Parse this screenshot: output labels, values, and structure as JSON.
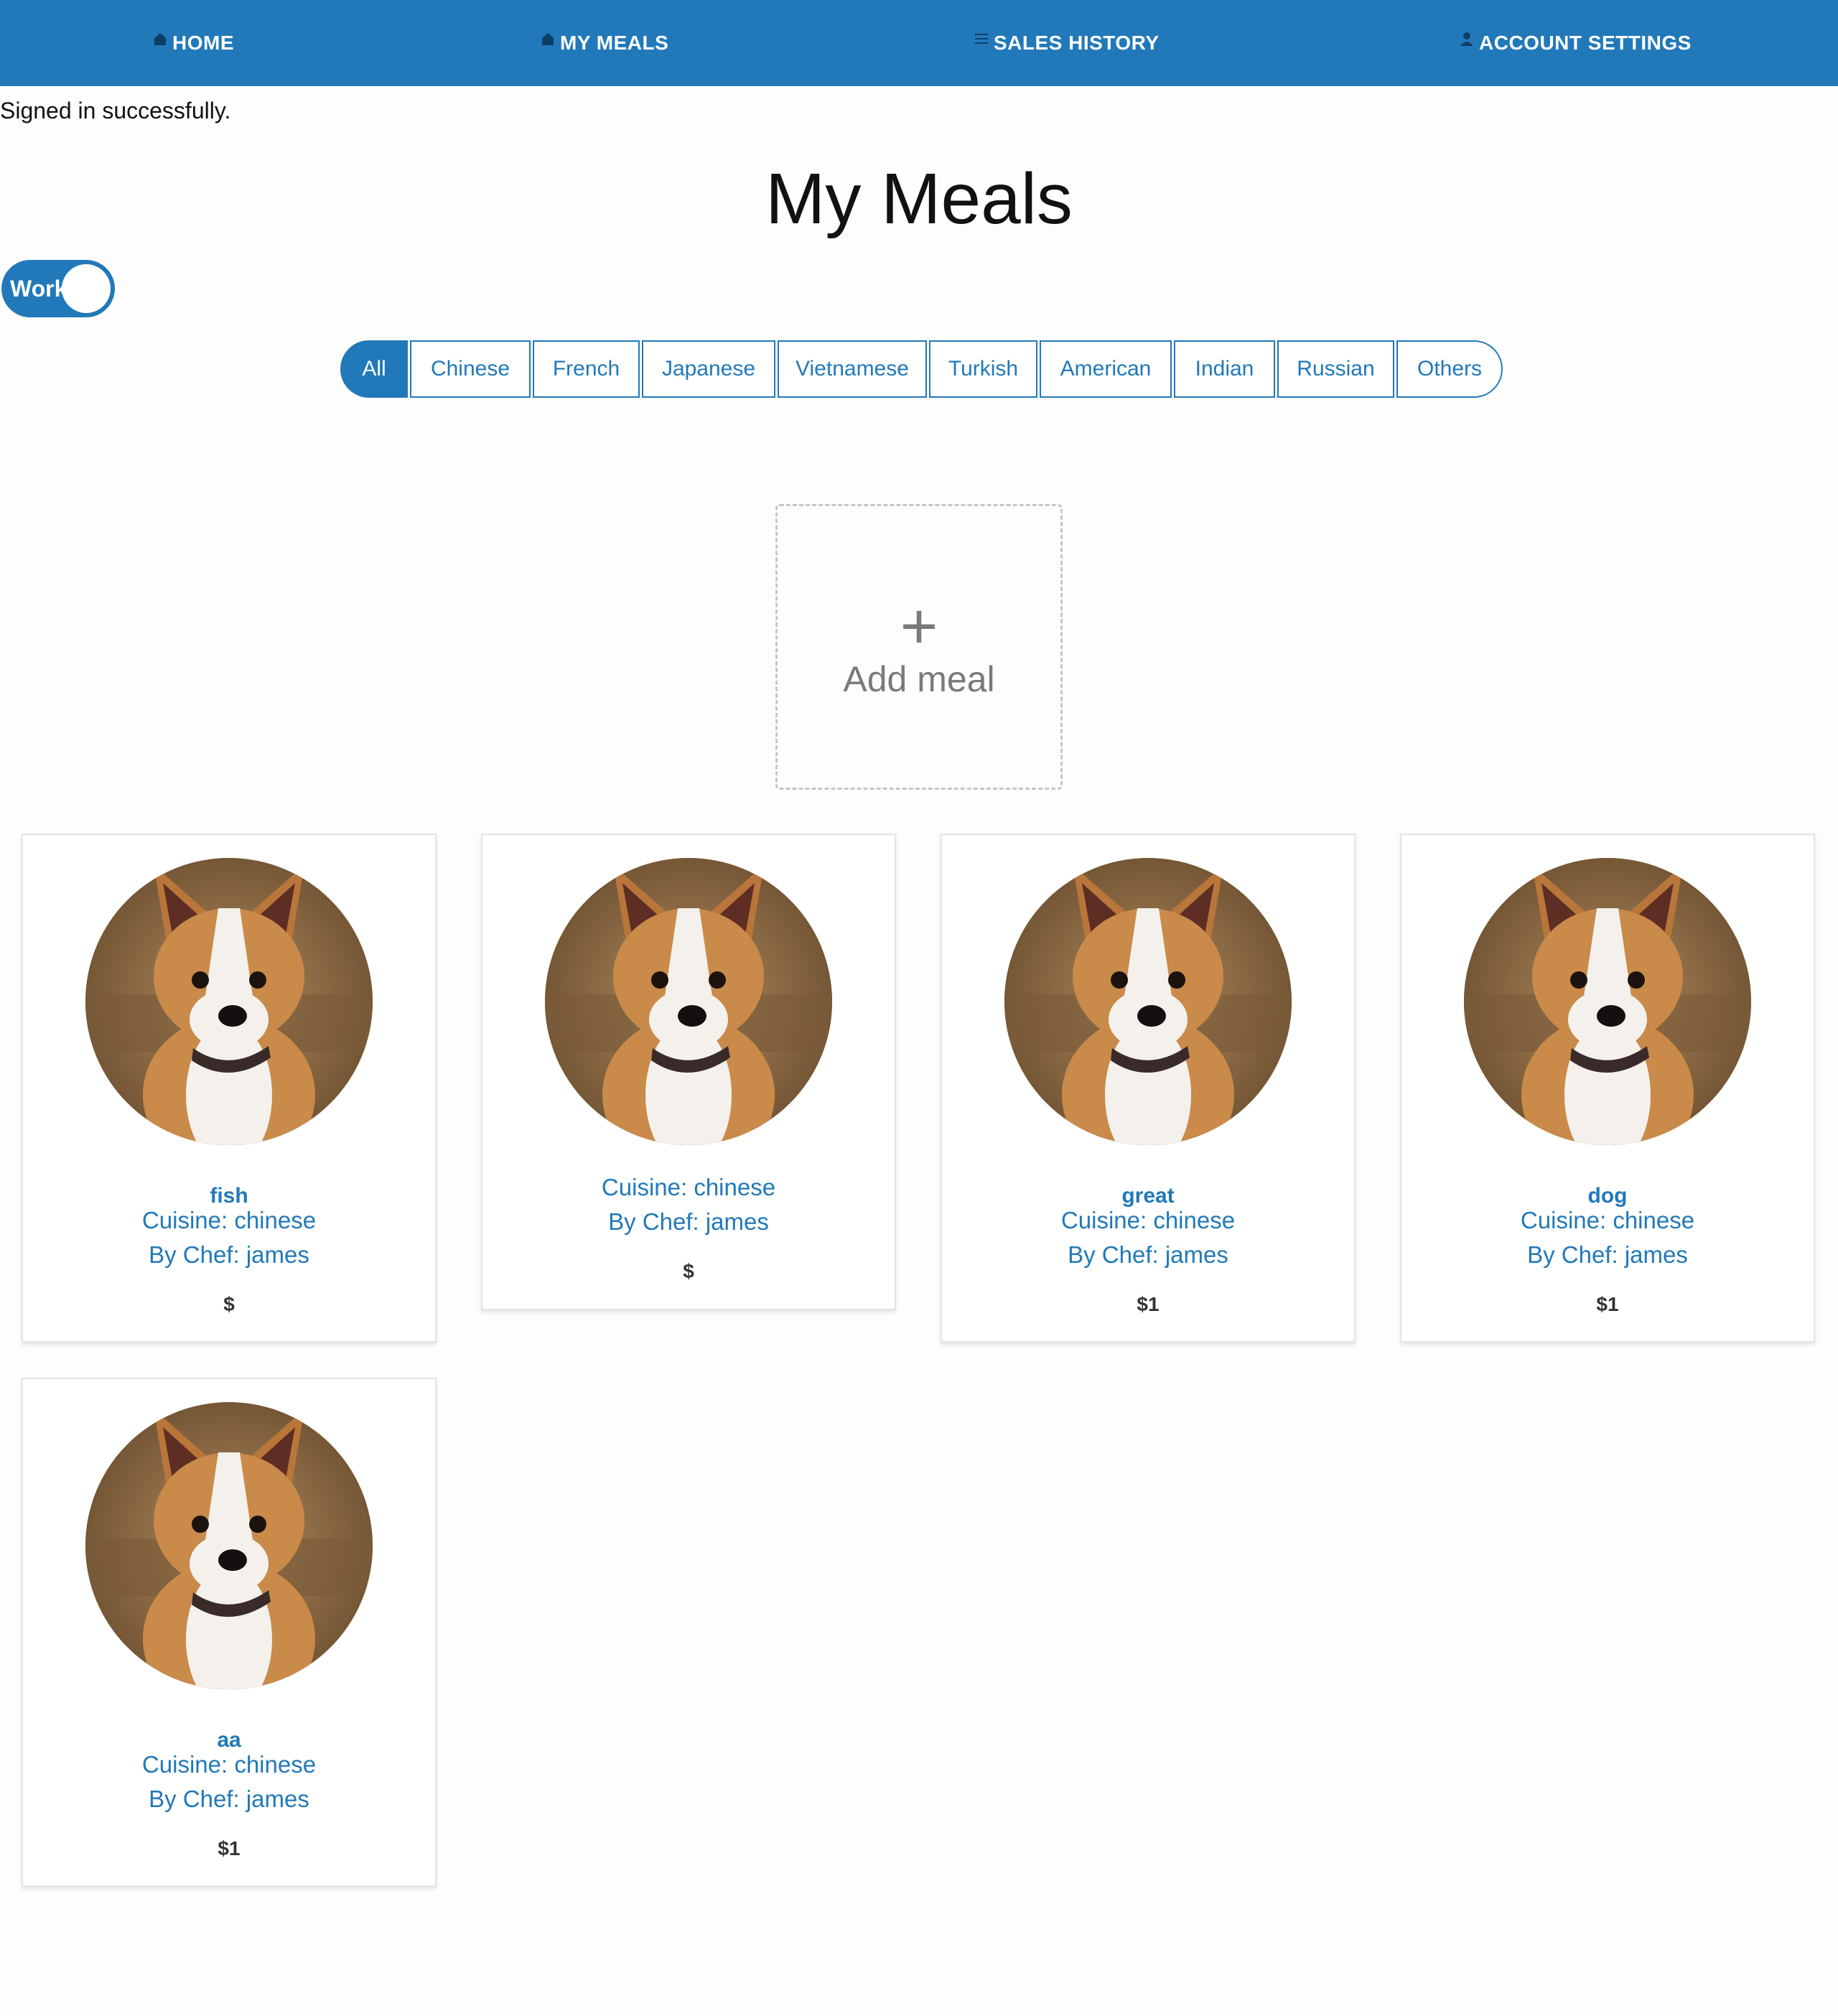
{
  "nav": {
    "items": [
      {
        "label": "HOME",
        "icon": "home-icon"
      },
      {
        "label": "MY MEALS",
        "icon": "home-icon"
      },
      {
        "label": "SALES HISTORY",
        "icon": "list-icon"
      },
      {
        "label": "ACCOUNT SETTINGS",
        "icon": "user-icon"
      }
    ]
  },
  "flash": "Signed in successfully.",
  "page_title": "My Meals",
  "toggle": {
    "label": "Work",
    "on": true
  },
  "filters": [
    "All",
    "Chinese",
    "French",
    "Japanese",
    "Vietnamese",
    "Turkish",
    "American",
    "Indian",
    "Russian",
    "Others"
  ],
  "add_meal": {
    "plus": "+",
    "label": "Add meal"
  },
  "meals": [
    {
      "name": "fish",
      "cuisine": "Cuisine: chinese",
      "chef": "By Chef: james",
      "price": "$"
    },
    {
      "name": "",
      "cuisine": "Cuisine: chinese",
      "chef": "By Chef: james",
      "price": "$"
    },
    {
      "name": "great",
      "cuisine": "Cuisine: chinese",
      "chef": "By Chef: james",
      "price": "$1"
    },
    {
      "name": "dog",
      "cuisine": "Cuisine: chinese",
      "chef": "By Chef: james",
      "price": "$1"
    },
    {
      "name": "aa",
      "cuisine": "Cuisine: chinese",
      "chef": "By Chef: james",
      "price": "$1"
    }
  ],
  "colors": {
    "primary": "#2179b9",
    "text": "#111111",
    "muted": "#7a7a7a"
  }
}
